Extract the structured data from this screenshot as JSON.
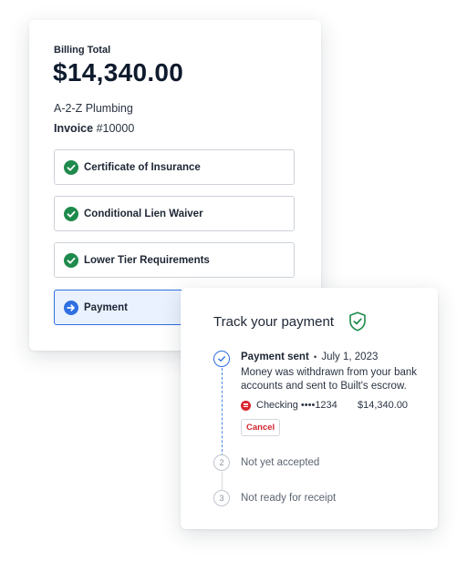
{
  "billing": {
    "label": "Billing Total",
    "amount": "$14,340.00",
    "vendor": "A-2-Z Plumbing",
    "invoice_label": "Invoice",
    "invoice_number": "#10000"
  },
  "requirements": [
    {
      "label": "Certificate of Insurance",
      "status": "complete",
      "icon": "check-circle-icon"
    },
    {
      "label": "Conditional Lien Waiver",
      "status": "complete",
      "icon": "check-circle-icon"
    },
    {
      "label": "Lower Tier Requirements",
      "status": "complete",
      "icon": "check-circle-icon"
    },
    {
      "label": "Payment",
      "status": "active",
      "icon": "arrow-right-circle-icon"
    }
  ],
  "tracker": {
    "title": "Track your payment",
    "steps": [
      {
        "title": "Payment sent",
        "separator": "•",
        "date": "July 1, 2023",
        "description": "Money was withdrawn from your bank accounts and sent to Built's escrow.",
        "account": "Checking ••••1234",
        "amount": "$14,340.00",
        "cancel_label": "Cancel"
      },
      {
        "number": "2",
        "label": "Not yet accepted"
      },
      {
        "number": "3",
        "label": "Not ready for receipt"
      }
    ]
  },
  "colors": {
    "success": "#1e8a4c",
    "primary": "#2f6fe0",
    "danger": "#d0262e"
  }
}
